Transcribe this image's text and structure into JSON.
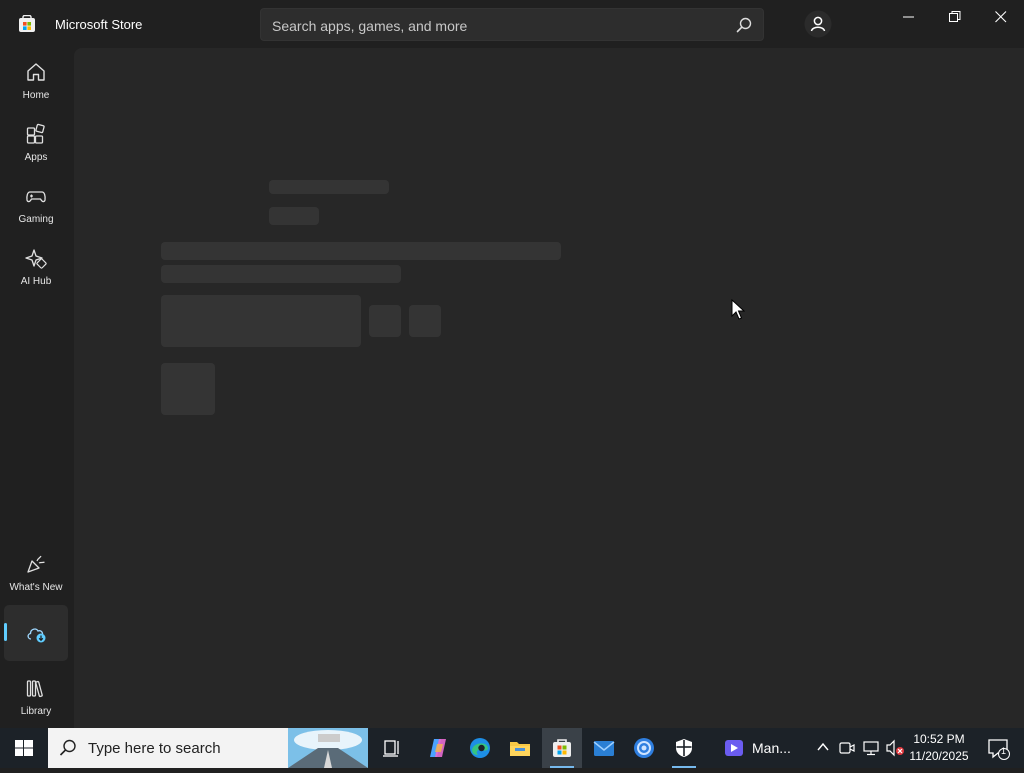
{
  "window": {
    "title": "Microsoft Store",
    "search_placeholder": "Search apps, games, and more"
  },
  "sidebar": {
    "items": [
      {
        "label": "Home",
        "icon": "home-icon"
      },
      {
        "label": "Apps",
        "icon": "apps-icon"
      },
      {
        "label": "Gaming",
        "icon": "gaming-icon"
      },
      {
        "label": "AI Hub",
        "icon": "ai-hub-icon"
      },
      {
        "label": "What's New",
        "icon": "whats-new-icon"
      },
      {
        "label": "",
        "icon": "cloud-download-icon",
        "active": true
      },
      {
        "label": "Library",
        "icon": "library-icon"
      }
    ]
  },
  "content": {
    "state": "loading"
  },
  "taskbar": {
    "search_placeholder": "Type here to search",
    "running_label": "Man...",
    "time": "10:52 PM",
    "date": "11/20/2025",
    "notification_count": "1"
  },
  "colors": {
    "accent": "#60cdff",
    "background": "#202020",
    "content_bg": "#272727",
    "skeleton": "#343434"
  }
}
